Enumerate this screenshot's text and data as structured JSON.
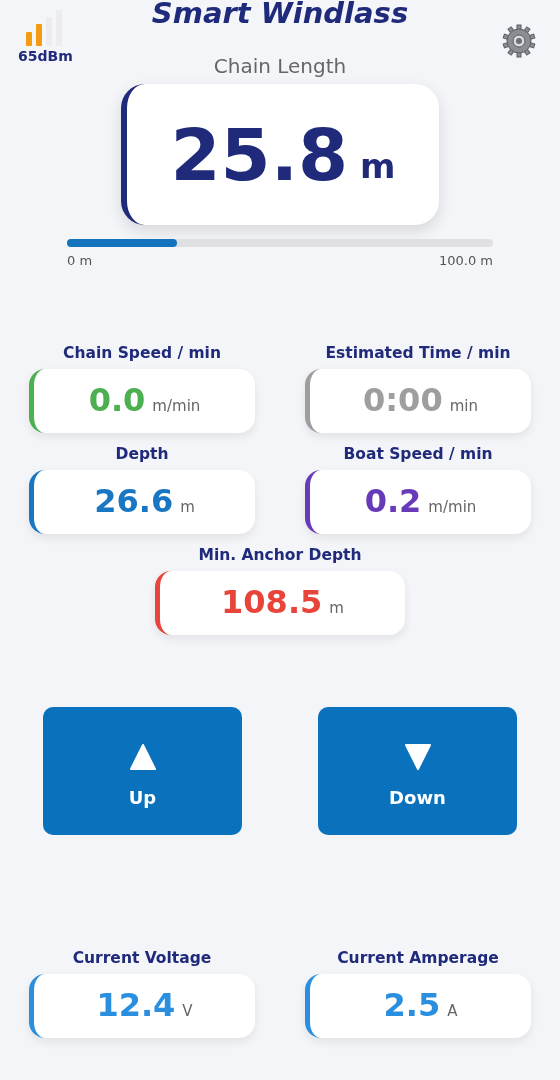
{
  "header": {
    "title": "Smart Windlass",
    "signal": "65dBm"
  },
  "chain": {
    "label": "Chain Length",
    "value": "25.8",
    "unit": "m",
    "level": 0.258,
    "min_label": "0 m",
    "max_label": "100.0 m"
  },
  "metrics": [
    {
      "label": "Chain Speed / min",
      "value": "0.0",
      "unit": "m/min",
      "color": "#4caf50"
    },
    {
      "label": "Estimated Time / min",
      "value": "0:00",
      "unit": "min",
      "color": "#9e9e9e"
    },
    {
      "label": "Depth",
      "value": "26.6",
      "unit": "m",
      "color": "#1976c2"
    },
    {
      "label": "Boat Speed / min",
      "value": "0.2",
      "unit": "m/min",
      "color": "#673ab7"
    },
    {
      "label": "Min. Anchor Depth",
      "value": "108.5",
      "unit": "m",
      "color": "#e8443a"
    }
  ],
  "controls": [
    {
      "kind": "up",
      "label": "Up"
    },
    {
      "kind": "down",
      "label": "Down"
    }
  ],
  "power": [
    {
      "label": "Current Voltage",
      "value": "12.4",
      "unit": "V",
      "color": "#2b8fe0"
    },
    {
      "label": "Current Amperage",
      "value": "2.5",
      "unit": "A",
      "color": "#2b8fe0"
    }
  ]
}
